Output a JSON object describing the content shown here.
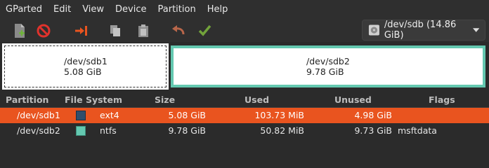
{
  "menubar": {
    "items": [
      "GParted",
      "Edit",
      "View",
      "Device",
      "Partition",
      "Help"
    ]
  },
  "toolbar": {
    "buttons": [
      {
        "name": "new-partition",
        "icon": "new-document-icon"
      },
      {
        "name": "delete-partition",
        "icon": "delete-icon"
      },
      {
        "name": "resize-move",
        "icon": "resize-move-icon"
      },
      {
        "name": "copy",
        "icon": "copy-icon"
      },
      {
        "name": "paste",
        "icon": "paste-icon"
      },
      {
        "name": "undo",
        "icon": "undo-icon"
      },
      {
        "name": "apply",
        "icon": "apply-check-icon"
      }
    ],
    "device": "/dev/sdb (14.86 GiB)"
  },
  "graph": {
    "partitions": [
      {
        "name": "/dev/sdb1",
        "size": "5.08 GiB"
      },
      {
        "name": "/dev/sdb2",
        "size": "9.78 GiB"
      }
    ]
  },
  "table": {
    "headers": [
      "Partition",
      "File System",
      "Size",
      "Used",
      "Unused",
      "Flags"
    ],
    "rows": [
      {
        "partition": "/dev/sdb1",
        "fs": "ext4",
        "fs_color": "#314e6c",
        "size": "5.08 GiB",
        "used": "103.73 MiB",
        "unused": "4.98 GiB",
        "flags": "",
        "selected": true
      },
      {
        "partition": "/dev/sdb2",
        "fs": "ntfs",
        "fs_color": "#64c8b0",
        "size": "9.78 GiB",
        "used": "50.82 MiB",
        "unused": "9.73 GiB",
        "flags": "msftdata",
        "selected": false
      }
    ]
  },
  "colors": {
    "selection": "#e9541f",
    "ntfs": "#64c8b0",
    "ext4": "#314e6c"
  }
}
